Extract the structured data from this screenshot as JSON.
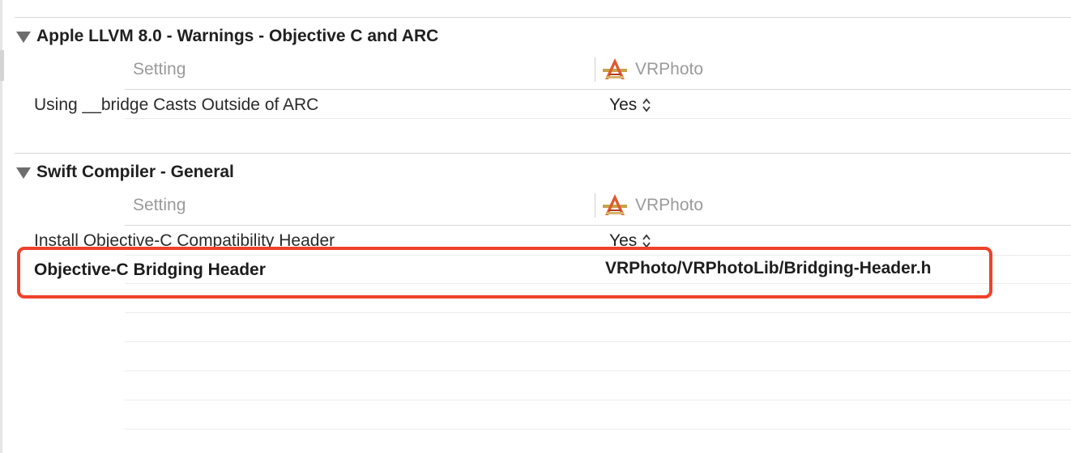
{
  "sections": [
    {
      "title": "Apple LLVM 8.0 - Warnings - Objective C and ARC",
      "header": {
        "setting_label": "Setting",
        "target_name": "VRPhoto",
        "target_icon": "xcode-app-icon"
      },
      "rows": [
        {
          "label": "Using __bridge Casts Outside of ARC",
          "value": "Yes",
          "has_stepper": true
        }
      ]
    },
    {
      "title": "Swift Compiler - General",
      "header": {
        "setting_label": "Setting",
        "target_name": "VRPhoto",
        "target_icon": "xcode-app-icon"
      },
      "rows": [
        {
          "label": "Install Objective-C Compatibility Header",
          "value": "Yes",
          "has_stepper": true
        },
        {
          "label": "Objective-C Bridging Header",
          "value": "VRPhoto/VRPhotoLib/Bridging-Header.h",
          "bold": true,
          "highlighted": true
        }
      ]
    }
  ],
  "colors": {
    "highlight": "#f0412a",
    "disclosure": "#6d6d6d",
    "header_text": "#9a9a9a"
  }
}
